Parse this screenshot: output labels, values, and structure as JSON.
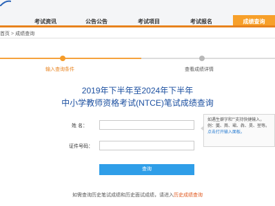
{
  "nav": {
    "items": [
      "考试资讯",
      "公告公告",
      "考试项目",
      "考试报名",
      "成绩查询"
    ],
    "active_index": 4,
    "accent": "#e8821c"
  },
  "breadcrumb": {
    "home": "首页",
    "separator": ">",
    "current": "成绩查询"
  },
  "steps": [
    {
      "label": "输入查询条件",
      "state": "active"
    },
    {
      "label": "查看成绩详情",
      "state": "inactive"
    }
  ],
  "title": {
    "line1": "2019年下半年至2024年下半年",
    "line2": "中小学教师资格考试(NTCE)笔试成绩查询"
  },
  "form": {
    "name_label": "姓    名：",
    "name_value": "",
    "id_label": "证件号码：",
    "id_value": ""
  },
  "tip": {
    "text": "如遇生僻字和\"\"支持快捷输入，例：龑、粦、珺、犇、昊、堃等。",
    "link": "点击打开输入面板。"
  },
  "submit_label": "查询",
  "footer": {
    "text": "如需查询历史笔试成绩和历史面试成绩，请进入",
    "link": "历史成绩查询"
  },
  "colors": {
    "title": "#1b4fa0",
    "button": "#2f9ee8",
    "active_step": "#f59c2a",
    "footer_link": "#e0571c"
  }
}
